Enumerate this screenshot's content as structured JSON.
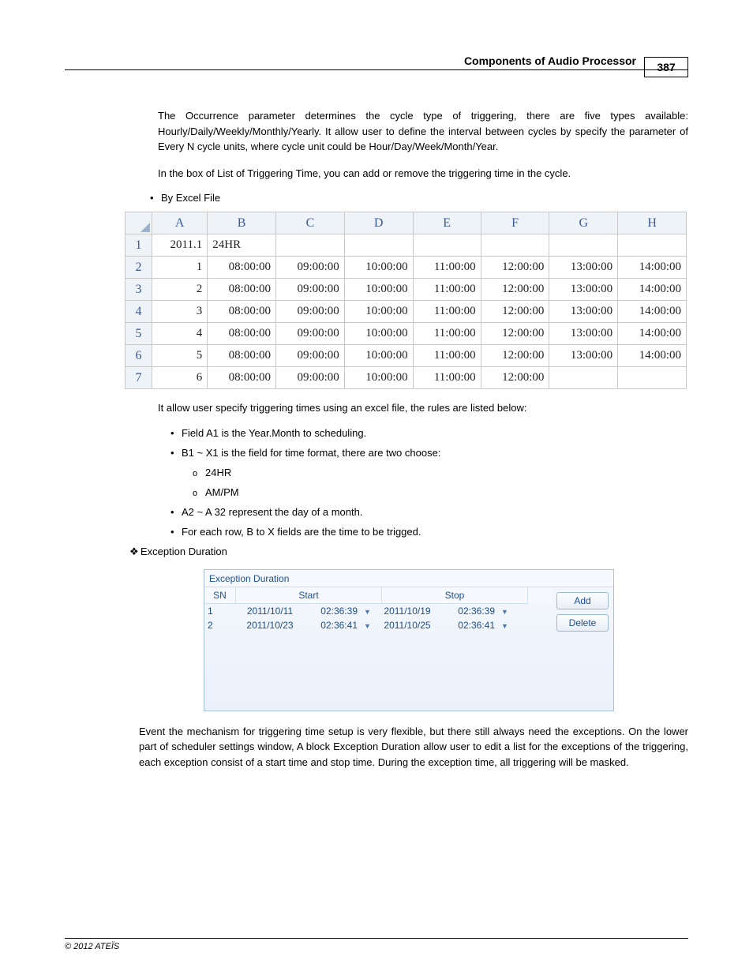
{
  "header": {
    "title": "Components of Audio Processor",
    "page_number": "387"
  },
  "paragraphs": {
    "p1": "The Occurrence parameter determines the cycle type of triggering, there are five types available: Hourly/Daily/Weekly/Monthly/Yearly. It allow user to define the interval between cycles by specify the parameter of Every N cycle units, where cycle unit could be Hour/Day/Week/Month/Year.",
    "p2": "In the box of List of Triggering Time, you can add or remove the triggering time in the cycle.",
    "p3": "It allow user specify triggering times using an excel file, the rules are listed below:",
    "p4": "Event the mechanism for triggering time setup is very flexible, but there still always need the exceptions. On the lower part of scheduler settings window, A block Exception Duration allow user to edit a list for the exceptions of the triggering, each exception consist of a start time and stop time. During the exception time, all triggering will be masked."
  },
  "bullets": {
    "by_excel": "By Excel File",
    "r1": "Field A1 is the Year.Month to scheduling.",
    "r2": "B1 ~ X1 is the field for time format, there are two choose:",
    "r2a": "24HR",
    "r2b": "AM/PM",
    "r3": "A2 ~ A 32 represent the day of a month.",
    "r4": "For each row, B to X fields are the time to be trigged."
  },
  "section_exception": "Exception Duration",
  "excel": {
    "cols": [
      "A",
      "B",
      "C",
      "D",
      "E",
      "F",
      "G",
      "H"
    ],
    "rows": [
      {
        "n": "1",
        "cells": [
          "2011.1",
          "24HR",
          "",
          "",
          "",
          "",
          "",
          ""
        ]
      },
      {
        "n": "2",
        "cells": [
          "1",
          "08:00:00",
          "09:00:00",
          "10:00:00",
          "11:00:00",
          "12:00:00",
          "13:00:00",
          "14:00:00"
        ]
      },
      {
        "n": "3",
        "cells": [
          "2",
          "08:00:00",
          "09:00:00",
          "10:00:00",
          "11:00:00",
          "12:00:00",
          "13:00:00",
          "14:00:00"
        ]
      },
      {
        "n": "4",
        "cells": [
          "3",
          "08:00:00",
          "09:00:00",
          "10:00:00",
          "11:00:00",
          "12:00:00",
          "13:00:00",
          "14:00:00"
        ]
      },
      {
        "n": "5",
        "cells": [
          "4",
          "08:00:00",
          "09:00:00",
          "10:00:00",
          "11:00:00",
          "12:00:00",
          "13:00:00",
          "14:00:00"
        ]
      },
      {
        "n": "6",
        "cells": [
          "5",
          "08:00:00",
          "09:00:00",
          "10:00:00",
          "11:00:00",
          "12:00:00",
          "13:00:00",
          "14:00:00"
        ]
      },
      {
        "n": "7",
        "cells": [
          "6",
          "08:00:00",
          "09:00:00",
          "10:00:00",
          "11:00:00",
          "12:00:00",
          "",
          ""
        ]
      }
    ]
  },
  "exception_panel": {
    "title": "Exception Duration",
    "headers": {
      "sn": "SN",
      "start": "Start",
      "stop": "Stop"
    },
    "rows": [
      {
        "sn": "1",
        "start_date": "2011/10/11",
        "start_time": "02:36:39",
        "stop_date": "2011/10/19",
        "stop_time": "02:36:39"
      },
      {
        "sn": "2",
        "start_date": "2011/10/23",
        "start_time": "02:36:41",
        "stop_date": "2011/10/25",
        "stop_time": "02:36:41"
      }
    ],
    "buttons": {
      "add": "Add",
      "delete": "Delete"
    }
  },
  "footer": "© 2012 ATEÏS"
}
